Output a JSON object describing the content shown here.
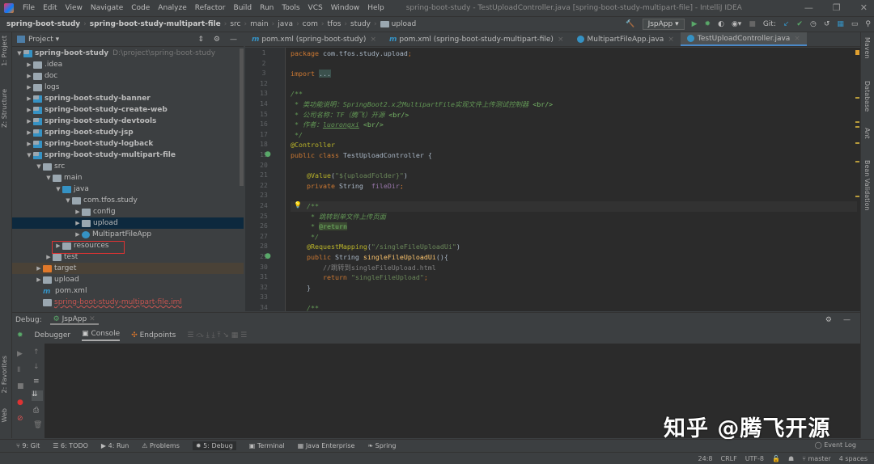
{
  "menu": [
    "File",
    "Edit",
    "View",
    "Navigate",
    "Code",
    "Analyze",
    "Refactor",
    "Build",
    "Run",
    "Tools",
    "VCS",
    "Window",
    "Help"
  ],
  "window_title": "spring-boot-study - TestUploadController.java [spring-boot-study-multipart-file] - IntelliJ IDEA",
  "breadcrumbs": [
    "spring-boot-study",
    "spring-boot-study-multipart-file",
    "src",
    "main",
    "java",
    "com",
    "tfos",
    "study",
    "upload"
  ],
  "toolbar": {
    "run_config": "JspApp",
    "git_label": "Git:"
  },
  "left_strip": {
    "project": "1: Project",
    "structure": "Z: Structure",
    "favorites": "2: Favorites",
    "web": "Web"
  },
  "project_header": "Project",
  "tree": [
    {
      "label": "spring-boot-study",
      "path": "D:\\project\\spring-boot-study",
      "lvl": 0,
      "arrow": "▼",
      "icon": "mod",
      "bold": true
    },
    {
      "label": ".idea",
      "lvl": 1,
      "arrow": "▶",
      "icon": "f"
    },
    {
      "label": "doc",
      "lvl": 1,
      "arrow": "▶",
      "icon": "f"
    },
    {
      "label": "logs",
      "lvl": 1,
      "arrow": "▶",
      "icon": "f"
    },
    {
      "label": "spring-boot-study-banner",
      "lvl": 1,
      "arrow": "▶",
      "icon": "mod",
      "bold": true
    },
    {
      "label": "spring-boot-study-create-web",
      "lvl": 1,
      "arrow": "▶",
      "icon": "mod",
      "bold": true
    },
    {
      "label": "spring-boot-study-devtools",
      "lvl": 1,
      "arrow": "▶",
      "icon": "mod",
      "bold": true
    },
    {
      "label": "spring-boot-study-jsp",
      "lvl": 1,
      "arrow": "▶",
      "icon": "mod",
      "bold": true
    },
    {
      "label": "spring-boot-study-logback",
      "lvl": 1,
      "arrow": "▶",
      "icon": "mod",
      "bold": true
    },
    {
      "label": "spring-boot-study-multipart-file",
      "lvl": 1,
      "arrow": "▼",
      "icon": "mod",
      "bold": true
    },
    {
      "label": "src",
      "lvl": 2,
      "arrow": "▼",
      "icon": "f"
    },
    {
      "label": "main",
      "lvl": 3,
      "arrow": "▼",
      "icon": "f"
    },
    {
      "label": "java",
      "lvl": 4,
      "arrow": "▼",
      "icon": "java"
    },
    {
      "label": "com.tfos.study",
      "lvl": 5,
      "arrow": "▼",
      "icon": "pkg"
    },
    {
      "label": "config",
      "lvl": 6,
      "arrow": "▶",
      "icon": "pkg"
    },
    {
      "label": "upload",
      "lvl": 6,
      "arrow": "▶",
      "icon": "pkg",
      "state": "sel"
    },
    {
      "label": "MultipartFileApp",
      "lvl": 6,
      "arrow": "▶",
      "icon": "cls"
    },
    {
      "label": "resources",
      "lvl": 4,
      "arrow": "▶",
      "icon": "f"
    },
    {
      "label": "test",
      "lvl": 3,
      "arrow": "▶",
      "icon": "f"
    },
    {
      "label": "target",
      "lvl": 2,
      "arrow": "▶",
      "icon": "orange",
      "state": "tgt"
    },
    {
      "label": "upload",
      "lvl": 2,
      "arrow": "▶",
      "icon": "f"
    },
    {
      "label": "pom.xml",
      "lvl": 2,
      "arrow": "",
      "icon": "m"
    },
    {
      "label": "spring-boot-study-multipart-file.iml",
      "lvl": 2,
      "arrow": "",
      "icon": "f",
      "color": "#c75450"
    }
  ],
  "tabs": [
    {
      "label": "pom.xml (spring-boot-study)",
      "icon": "m"
    },
    {
      "label": "pom.xml (spring-boot-study-multipart-file)",
      "icon": "m"
    },
    {
      "label": "MultipartFileApp.java",
      "icon": "c"
    },
    {
      "label": "TestUploadController.java",
      "icon": "c",
      "active": true
    }
  ],
  "code": [
    {
      "n": "1",
      "t": [
        [
          "package ",
          "kw"
        ],
        [
          "com.tfos.study.upload",
          ""
        ],
        [
          ";",
          "kw"
        ]
      ]
    },
    {
      "n": "2",
      "t": []
    },
    {
      "n": "3",
      "t": [
        [
          "import ",
          "kw"
        ],
        [
          "...",
          "fold"
        ]
      ]
    },
    {
      "n": "12",
      "t": []
    },
    {
      "n": "13",
      "t": [
        [
          "/**",
          "cm"
        ]
      ]
    },
    {
      "n": "14",
      "t": [
        [
          " * 类功能说明：SpringBoot2.x之MultipartFile实现文件上传测试控制器 ",
          "cm"
        ],
        [
          "<br/>",
          "tag"
        ]
      ]
    },
    {
      "n": "15",
      "t": [
        [
          " * 公司名称：TF（腾飞）开源 ",
          "cm"
        ],
        [
          "<br/>",
          "tag"
        ]
      ]
    },
    {
      "n": "16",
      "t": [
        [
          " * 作者：",
          "cm"
        ],
        [
          "luorongxi",
          "cm u"
        ],
        [
          " ",
          "cm"
        ],
        [
          "<br/>",
          "tag"
        ]
      ]
    },
    {
      "n": "17",
      "t": [
        [
          " */",
          "cm"
        ]
      ]
    },
    {
      "n": "18",
      "t": [
        [
          "@Controller",
          "an"
        ]
      ]
    },
    {
      "n": "19",
      "t": [
        [
          "public class ",
          "kw"
        ],
        [
          "TestUploadController {",
          ""
        ]
      ]
    },
    {
      "n": "20",
      "t": []
    },
    {
      "n": "21",
      "t": [
        [
          "    @Value",
          "an"
        ],
        [
          "(",
          ""
        ],
        [
          "\"${uploadFolder}\"",
          "st"
        ],
        [
          ")",
          ""
        ]
      ]
    },
    {
      "n": "22",
      "t": [
        [
          "    private ",
          "kw"
        ],
        [
          "String  ",
          ""
        ],
        [
          "fileDir",
          "fd"
        ],
        [
          ";",
          "kw"
        ]
      ]
    },
    {
      "n": "23",
      "t": []
    },
    {
      "n": "24",
      "t": [
        [
          "    /**",
          "cm"
        ]
      ],
      "cur": true
    },
    {
      "n": "25",
      "t": [
        [
          "     * 跳转到单文件上传页面",
          "cm"
        ]
      ]
    },
    {
      "n": "26",
      "t": [
        [
          "     * ",
          "cm"
        ],
        [
          "@return",
          "doc"
        ]
      ]
    },
    {
      "n": "27",
      "t": [
        [
          "     */",
          "cm"
        ]
      ]
    },
    {
      "n": "28",
      "t": [
        [
          "    @RequestMapping",
          "an"
        ],
        [
          "(",
          ""
        ],
        [
          "\"/singleFileUploadUi\"",
          "st"
        ],
        [
          ")",
          ""
        ]
      ]
    },
    {
      "n": "29",
      "t": [
        [
          "    public ",
          "kw"
        ],
        [
          "String ",
          ""
        ],
        [
          "singleFileUploadUi",
          "fn"
        ],
        [
          "(){",
          ""
        ]
      ]
    },
    {
      "n": "30",
      "t": [
        [
          "        //跳转到singleFileUpload.html",
          "lc"
        ]
      ]
    },
    {
      "n": "31",
      "t": [
        [
          "        return ",
          "kw"
        ],
        [
          "\"singleFileUpload\"",
          "st"
        ],
        [
          ";",
          "kw"
        ]
      ]
    },
    {
      "n": "32",
      "t": [
        [
          "    }",
          ""
        ]
      ]
    },
    {
      "n": "33",
      "t": []
    },
    {
      "n": "34",
      "t": [
        [
          "    /**",
          "cm"
        ]
      ]
    }
  ],
  "right_strip": [
    "Maven",
    "Database",
    "Ant",
    "Bean Validation"
  ],
  "debug": {
    "label": "Debug:",
    "session": "JspApp",
    "tabs": [
      "Debugger",
      "Console",
      "Endpoints"
    ]
  },
  "bottom_tabs": [
    "9: Git",
    "6: TODO",
    "4: Run",
    "Problems",
    "5: Debug",
    "Terminal",
    "Java Enterprise",
    "Spring"
  ],
  "event_log": "Event Log",
  "status": {
    "position": "24:8",
    "line_sep": "CRLF",
    "encoding": "UTF-8",
    "branch": "master",
    "indent": "4 spaces"
  },
  "watermark": "知乎 @腾飞开源"
}
